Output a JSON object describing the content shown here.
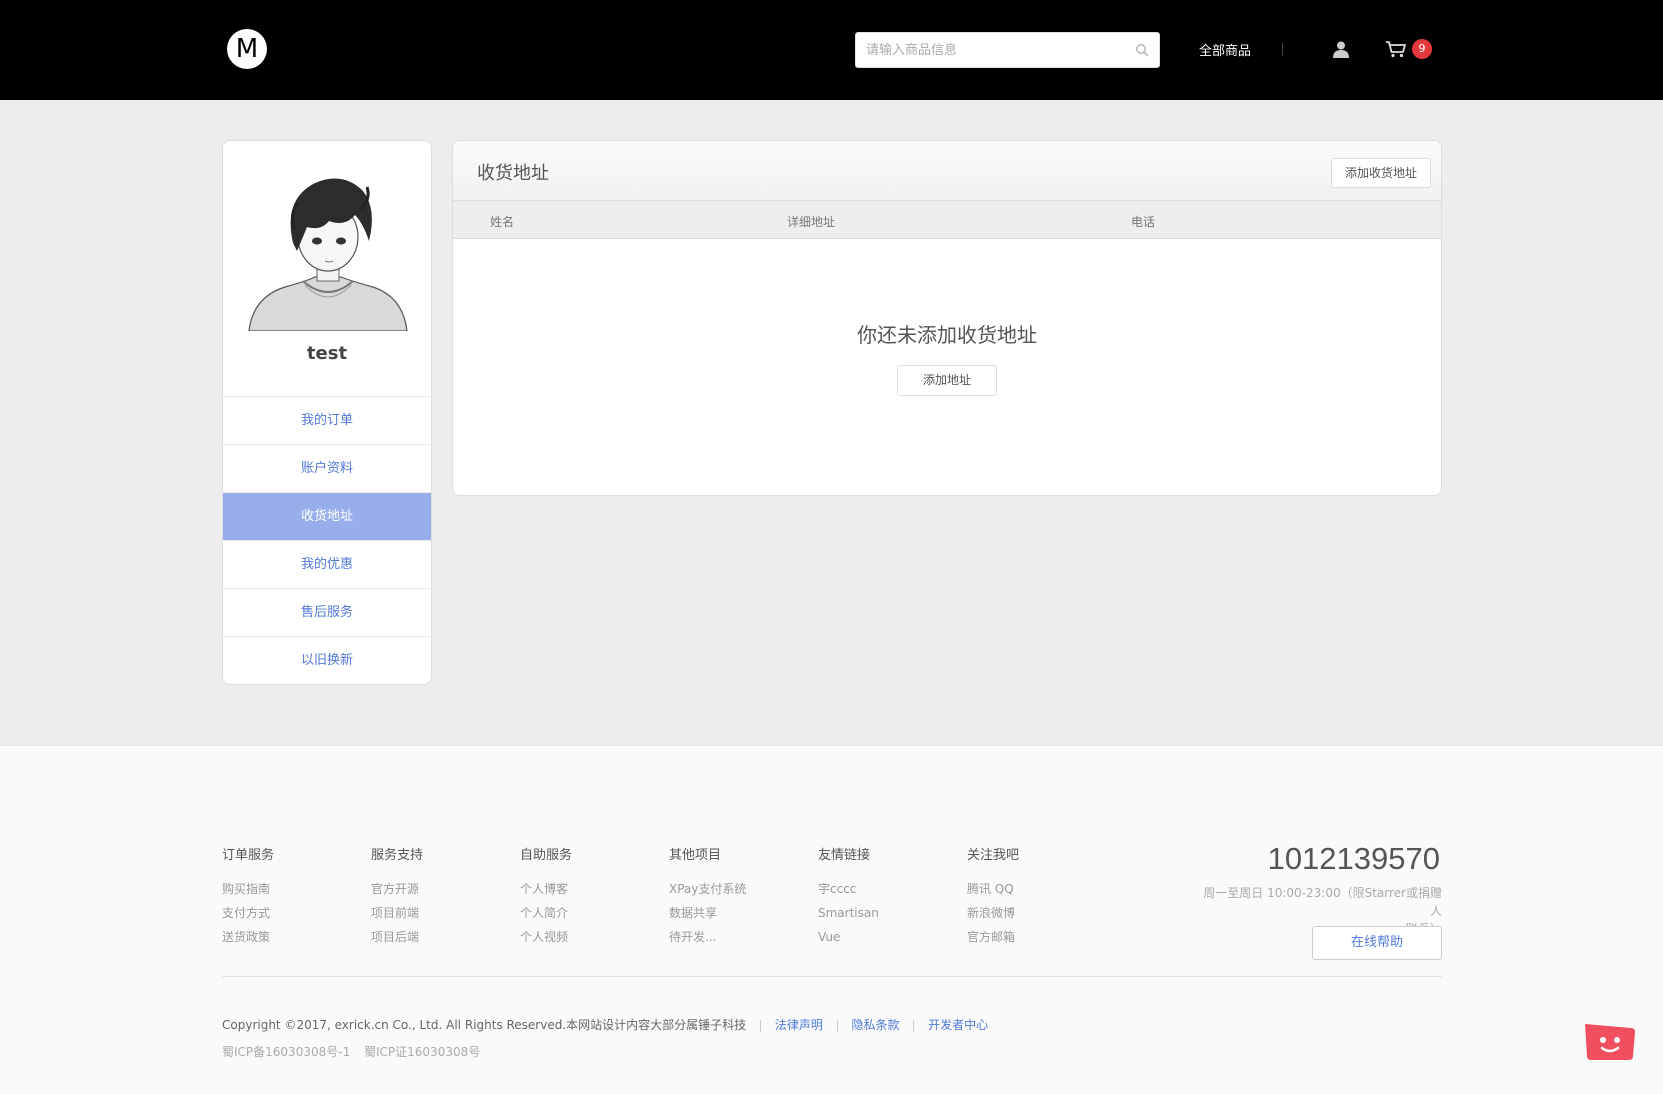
{
  "header": {
    "logo_letter": "M",
    "search_placeholder": "请输入商品信息",
    "nav_all": "全部商品",
    "cart_count": "9"
  },
  "sidebar": {
    "username": "test",
    "items": [
      {
        "label": "我的订单",
        "active": false
      },
      {
        "label": "账户资料",
        "active": false
      },
      {
        "label": "收货地址",
        "active": true
      },
      {
        "label": "我的优惠",
        "active": false
      },
      {
        "label": "售后服务",
        "active": false
      },
      {
        "label": "以旧换新",
        "active": false
      }
    ]
  },
  "main": {
    "title": "收货地址",
    "add_button": "添加收货地址",
    "columns": [
      "姓名",
      "详细地址",
      "电话"
    ],
    "empty_message": "你还未添加收货地址",
    "empty_button": "添加地址"
  },
  "footer": {
    "columns": [
      {
        "title": "订单服务",
        "links": [
          "购买指南",
          "支付方式",
          "送货政策"
        ]
      },
      {
        "title": "服务支持",
        "links": [
          "官方开源",
          "项目前端",
          "项目后端"
        ]
      },
      {
        "title": "自助服务",
        "links": [
          "个人博客",
          "个人简介",
          "个人视频"
        ]
      },
      {
        "title": "其他项目",
        "links": [
          "XPay支付系统",
          "数据共享",
          "待开发..."
        ]
      },
      {
        "title": "友情链接",
        "links": [
          "宇cccc",
          "Smartisan",
          "Vue"
        ]
      },
      {
        "title": "关注我吧",
        "links": [
          "腾讯 QQ",
          "新浪微博",
          "官方邮箱"
        ]
      }
    ],
    "phone": "1012139570",
    "hours_line1": "周一至周日 10:00-23:00（限Starrer或捐赠人",
    "hours_line2": "联系）",
    "help_button": "在线帮助",
    "copyright": "Copyright ©2017, exrick.cn Co., Ltd. All Rights Reserved.本网站设计内容大部分属锤子科技",
    "legal_links": [
      "法律声明",
      "隐私条款",
      "开发者中心"
    ],
    "icp_1": "蜀ICP备16030308号-1",
    "icp_2": "蜀ICP证16030308号"
  },
  "colors": {
    "accent": "#5079d9",
    "active_menu": "#98aeea",
    "badge": "#e4393c",
    "header_bg": "#000000",
    "chat_bubble": "#f04f5f"
  }
}
